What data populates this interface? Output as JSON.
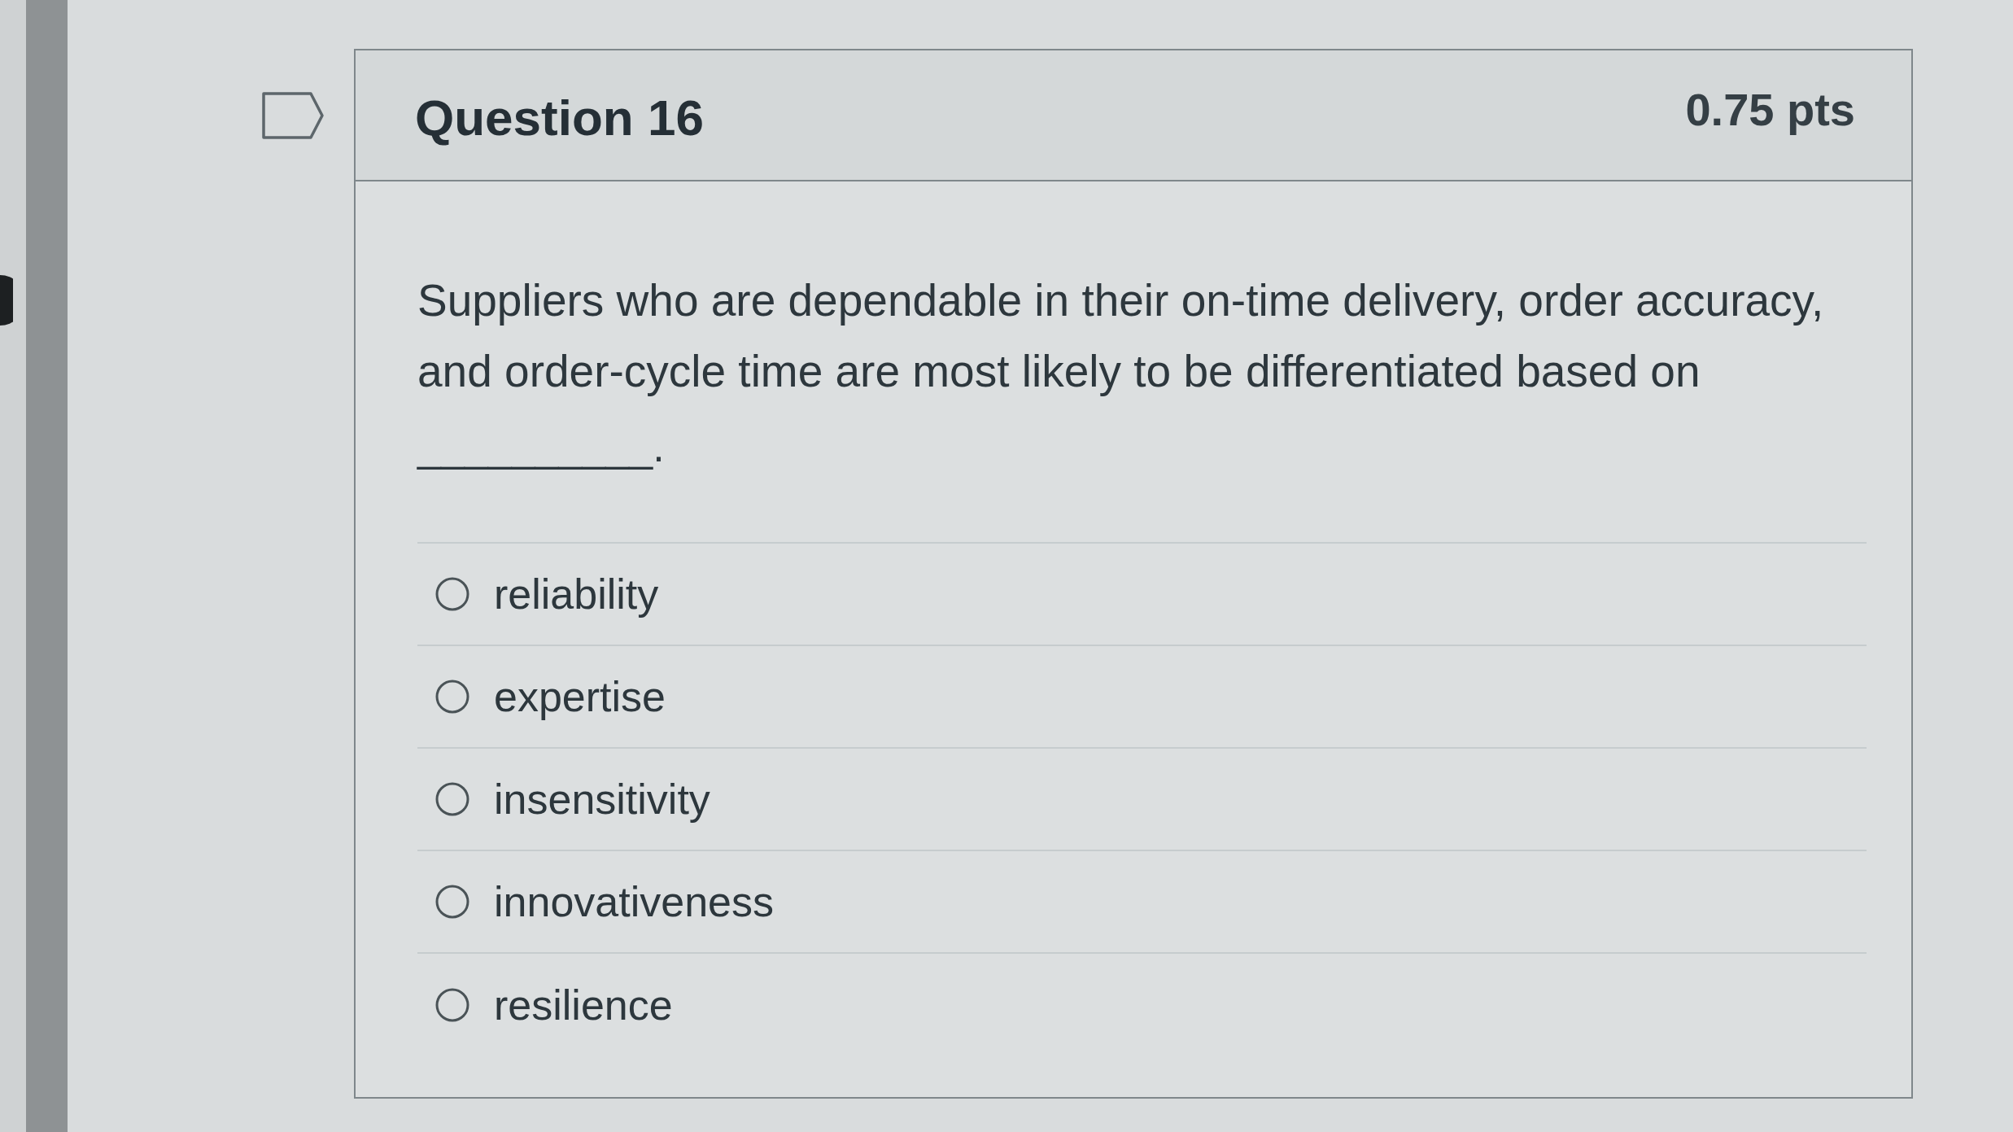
{
  "question": {
    "title": "Question 16",
    "points": "0.75 pts",
    "text": "Suppliers who are dependable in their on-time delivery, order accuracy, and order-cycle time are most likely to be differentiated based on",
    "blank": "__________."
  },
  "answers": [
    {
      "label": "reliability",
      "selected": false
    },
    {
      "label": "expertise",
      "selected": false
    },
    {
      "label": "insensitivity",
      "selected": false
    },
    {
      "label": "innovativeness",
      "selected": false
    },
    {
      "label": "resilience",
      "selected": false
    }
  ]
}
